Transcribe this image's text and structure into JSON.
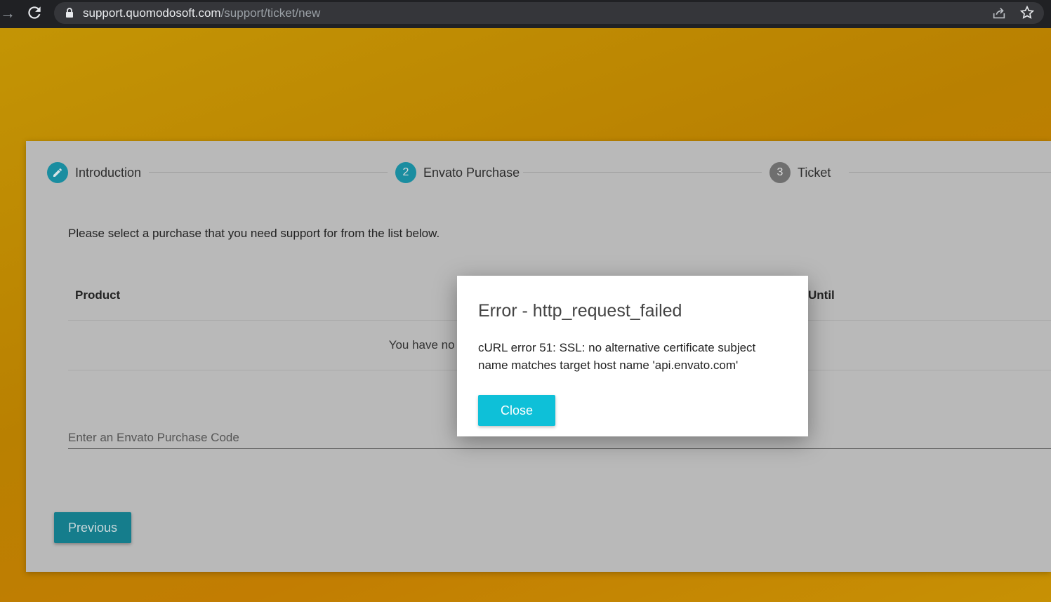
{
  "browser": {
    "url_host": "support.quomodosoft.com",
    "url_path": "/support/ticket/new"
  },
  "stepper": {
    "steps": [
      {
        "number": "",
        "label": "Introduction",
        "state": "done"
      },
      {
        "number": "2",
        "label": "Envato Purchase",
        "state": "active"
      },
      {
        "number": "3",
        "label": "Ticket",
        "state": "pending"
      }
    ]
  },
  "main": {
    "intro": "Please select a purchase that you need support for from the list below.",
    "table": {
      "headers": [
        "Product",
        "Until"
      ]
    },
    "empty_message": "You have no purchases listed below",
    "purchase_code_placeholder": "Enter an Envato Purchase Code",
    "previous_label": "Previous"
  },
  "modal": {
    "title": "Error - http_request_failed",
    "body": "cURL error 51: SSL: no alternative certificate subject name matches target host name 'api.envato.com'",
    "close_label": "Close"
  },
  "colors": {
    "teal_dimmed": "#1a8da0",
    "gray_step": "#6f6f6f",
    "close_button": "#0ec0d8",
    "previous_button": "#157d8c"
  },
  "icons": [
    "arrow-forward-icon",
    "reload-icon",
    "lock-icon",
    "share-icon",
    "star-icon",
    "pencil-icon"
  ]
}
